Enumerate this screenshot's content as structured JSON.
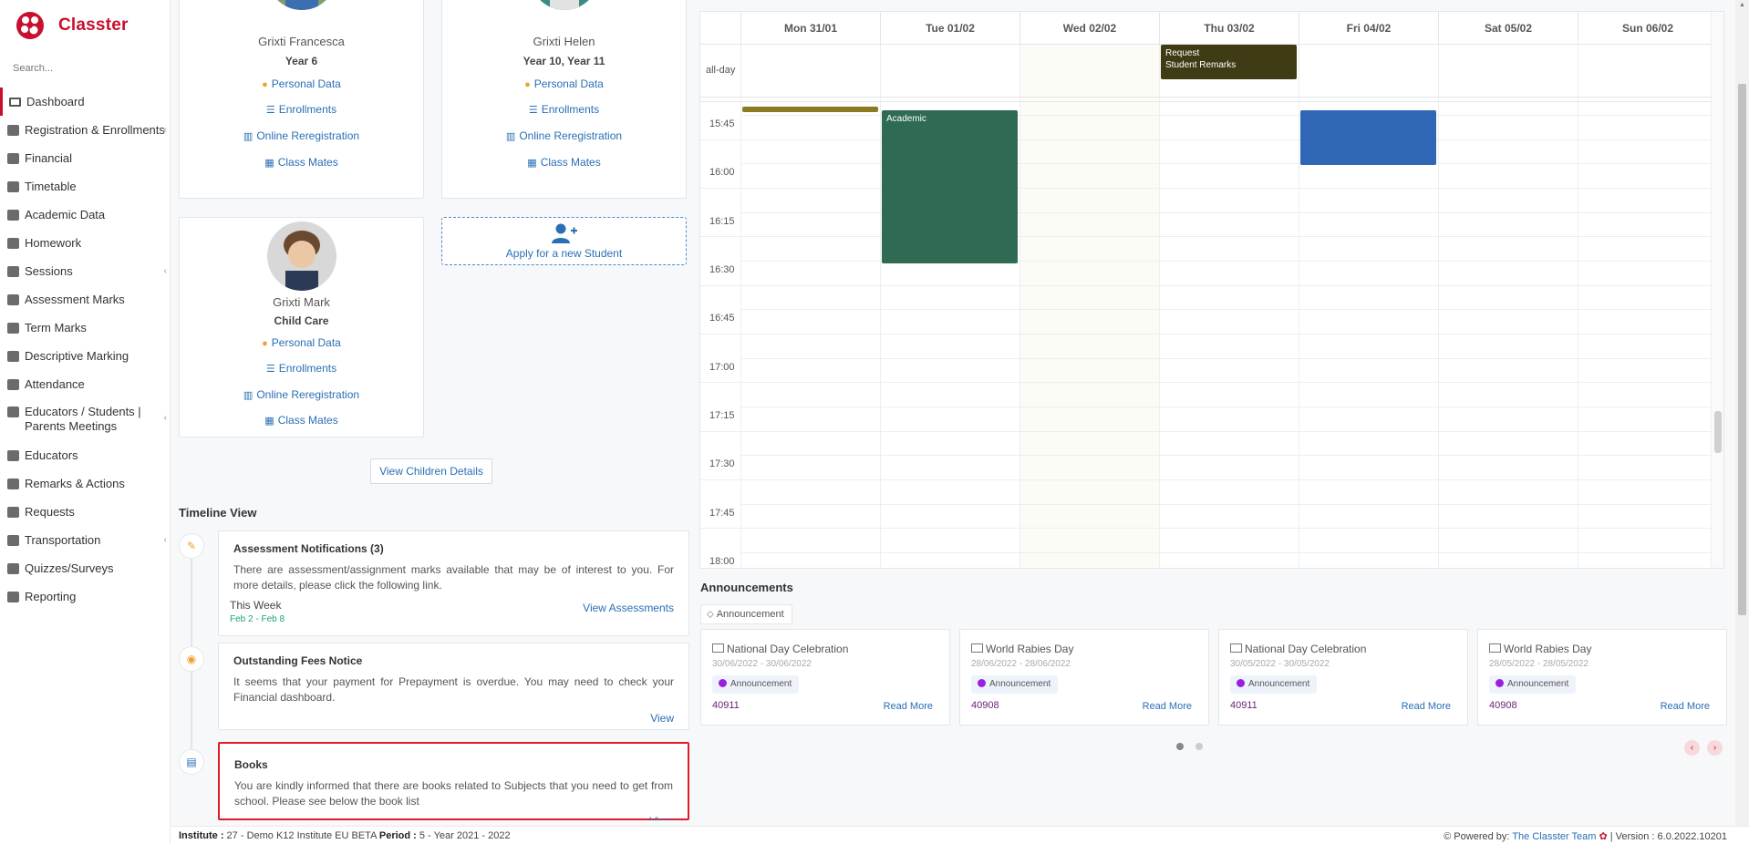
{
  "brand": {
    "name": "Classter"
  },
  "search": {
    "placeholder": "Search..."
  },
  "nav": [
    {
      "label": "Dashboard",
      "icon": "monitor-icon",
      "chevron": false,
      "active": true
    },
    {
      "label": "Registration & Enrollments",
      "icon": "institution-icon",
      "chevron": true
    },
    {
      "label": "Financial",
      "icon": "coins-icon",
      "chevron": false
    },
    {
      "label": "Timetable",
      "icon": "calendar-icon",
      "chevron": false
    },
    {
      "label": "Academic Data",
      "icon": "user-card-icon",
      "chevron": false
    },
    {
      "label": "Homework",
      "icon": "list-icon",
      "chevron": false
    },
    {
      "label": "Sessions",
      "icon": "presentation-icon",
      "chevron": true
    },
    {
      "label": "Assessment Marks",
      "icon": "edit-icon",
      "chevron": false
    },
    {
      "label": "Term Marks",
      "icon": "calculator-icon",
      "chevron": false
    },
    {
      "label": "Descriptive Marking",
      "icon": "pencil-icon",
      "chevron": false
    },
    {
      "label": "Attendance",
      "icon": "user-check-icon",
      "chevron": false
    },
    {
      "label": "Educators / Students | Parents Meetings",
      "icon": "users-icon",
      "chevron": true
    },
    {
      "label": "Educators",
      "icon": "users-icon",
      "chevron": false
    },
    {
      "label": "Remarks & Actions",
      "icon": "shuffle-icon",
      "chevron": false
    },
    {
      "label": "Requests",
      "icon": "file-icon",
      "chevron": false
    },
    {
      "label": "Transportation",
      "icon": "bus-icon",
      "chevron": true
    },
    {
      "label": "Quizzes/Surveys",
      "icon": "clipboard-icon",
      "chevron": false
    },
    {
      "label": "Reporting",
      "icon": "printer-icon",
      "chevron": false
    }
  ],
  "students": [
    {
      "name": "Grixti Francesca",
      "year": "Year 6",
      "links": [
        "Personal Data",
        "Enrollments",
        "Online Reregistration",
        "Class Mates"
      ]
    },
    {
      "name": "Grixti Helen",
      "year": "Year 10, Year 11",
      "links": [
        "Personal Data",
        "Enrollments",
        "Online Reregistration",
        "Class Mates"
      ]
    },
    {
      "name": "Grixti Mark",
      "year": "Child Care",
      "links": [
        "Personal Data",
        "Enrollments",
        "Online Reregistration",
        "Class Mates"
      ]
    }
  ],
  "apply_new_student": "Apply for a new Student",
  "view_children_details": "View Children Details",
  "timeline": {
    "title": "Timeline View",
    "items": [
      {
        "title": "Assessment Notifications (3)",
        "text": "There are assessment/assignment marks available that may be of interest to you. For more details, please click the following link.",
        "when": "This Week",
        "range": "Feb 2 - Feb 8",
        "action": "View Assessments",
        "icon": "edit-icon"
      },
      {
        "title": "Outstanding Fees Notice",
        "text": "It seems that your payment for Prepayment is overdue. You may need to check your Financial dashboard.",
        "action": "View",
        "icon": "coins-icon"
      },
      {
        "title": "Books",
        "text": "You are kindly informed that there are books related to Subjects that you need to get from school. Please see below the book list",
        "action": "View",
        "icon": "book-icon"
      }
    ]
  },
  "calendar": {
    "days": [
      "Mon 31/01",
      "Tue 01/02",
      "Wed 02/02",
      "Thu 03/02",
      "Fri 04/02",
      "Sat 05/02",
      "Sun 06/02"
    ],
    "allday_label": "all-day",
    "allday_event": {
      "line1": "Request",
      "line2": "Student Remarks",
      "color": "#3f3b14"
    },
    "times": [
      "15:45",
      "16:00",
      "16:15",
      "16:30",
      "16:45",
      "17:00",
      "17:15",
      "17:30",
      "17:45",
      "18:00"
    ],
    "events": [
      {
        "label": "",
        "color": "#8a7a22"
      },
      {
        "label": "Academic",
        "color": "#2e6b52"
      },
      {
        "label": "",
        "color": "#2f67b5"
      }
    ]
  },
  "announcements": {
    "title": "Announcements",
    "filter": "Announcement",
    "items": [
      {
        "title": "National Day Celebration",
        "dates": "30/06/2022 - 30/06/2022",
        "badge": "Announcement",
        "code": "40911",
        "action": "Read More"
      },
      {
        "title": "World Rabies Day",
        "dates": "28/06/2022 - 28/06/2022",
        "badge": "Announcement",
        "code": "40908",
        "action": "Read More"
      },
      {
        "title": "National Day Celebration",
        "dates": "30/05/2022 - 30/05/2022",
        "badge": "Announcement",
        "code": "40911",
        "action": "Read More"
      },
      {
        "title": "World Rabies Day",
        "dates": "28/05/2022 - 28/05/2022",
        "badge": "Announcement",
        "code": "40908",
        "action": "Read More"
      }
    ]
  },
  "footer": {
    "institute_label": "Institute :",
    "institute_value": " 27 - Demo K12 Institute EU BETA ",
    "period_label": "Period :",
    "period_value": " 5 - Year 2021 - 2022",
    "powered_label": "Powered by: ",
    "powered_team": "The Classter Team",
    "version": " | Version : 6.0.2022.10201"
  },
  "colors": {
    "brand": "#c8102e",
    "link": "#2a6fb4",
    "highlight": "#e01b24"
  }
}
